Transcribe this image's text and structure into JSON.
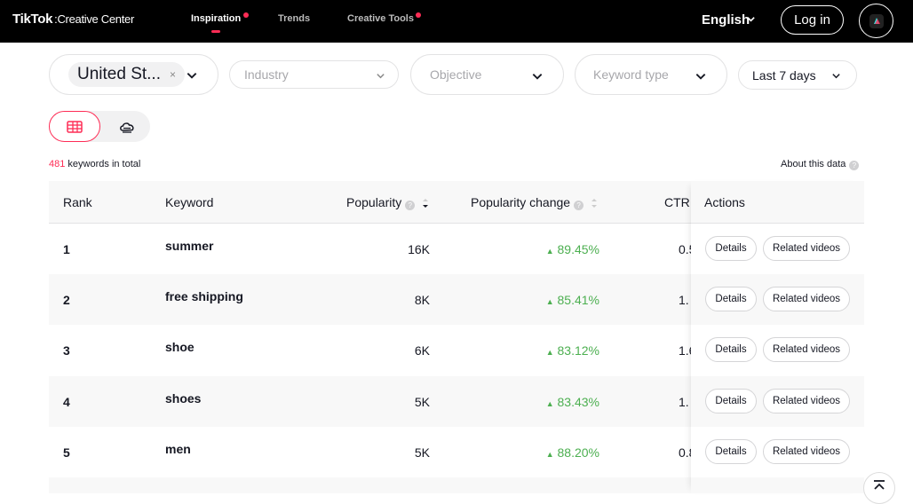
{
  "header": {
    "logo": "TikTok",
    "logo_sub": "Creative Center",
    "nav": [
      {
        "label": "Inspiration",
        "active": true,
        "dot": true
      },
      {
        "label": "Trends",
        "active": false,
        "dot": false
      },
      {
        "label": "Creative Tools",
        "active": false,
        "dot": true
      }
    ],
    "language": "English",
    "login_label": "Log in"
  },
  "filters": {
    "country": "United St...",
    "industry_placeholder": "Industry",
    "objective_placeholder": "Objective",
    "keyword_type_placeholder": "Keyword type",
    "period": "Last 7 days"
  },
  "summary": {
    "count": "481",
    "suffix": "keywords in total",
    "about": "About this data"
  },
  "table": {
    "headers": {
      "rank": "Rank",
      "keyword": "Keyword",
      "popularity": "Popularity",
      "popularity_change": "Popularity change",
      "ctr": "CTR",
      "actions": "Actions"
    },
    "details_label": "Details",
    "related_label": "Related videos",
    "rows": [
      {
        "rank": "1",
        "keyword": "summer",
        "popularity": "16K",
        "change": "89.45%",
        "ctr": "0.5"
      },
      {
        "rank": "2",
        "keyword": "free shipping",
        "popularity": "8K",
        "change": "85.41%",
        "ctr": "1."
      },
      {
        "rank": "3",
        "keyword": "shoe",
        "popularity": "6K",
        "change": "83.12%",
        "ctr": "1.6"
      },
      {
        "rank": "4",
        "keyword": "shoes",
        "popularity": "5K",
        "change": "83.43%",
        "ctr": "1."
      },
      {
        "rank": "5",
        "keyword": "men",
        "popularity": "5K",
        "change": "88.20%",
        "ctr": "0.8"
      }
    ]
  },
  "colors": {
    "accent": "#fe2c55",
    "positive": "#4caf50"
  }
}
